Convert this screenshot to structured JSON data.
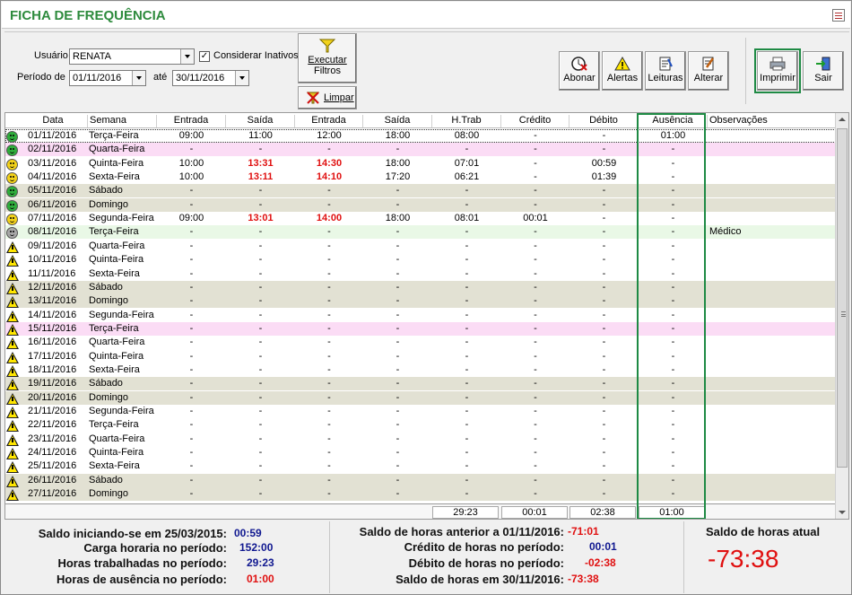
{
  "window": {
    "title": "FICHA DE FREQUÊNCIA"
  },
  "filters": {
    "usuario_label": "Usuário",
    "usuario_value": "RENATA",
    "inativos_label": "Considerar Inativos",
    "inativos_checked": "✓",
    "periodo_label": "Período de",
    "periodo_de": "01/11/2016",
    "ate_label": "até",
    "periodo_ate": "30/11/2016",
    "executar_label1": "Executar",
    "executar_label2": "Filtros",
    "limpar_label": "Limpar"
  },
  "toolbar": {
    "abonar": "Abonar",
    "alertas": "Alertas",
    "leituras": "Leituras",
    "alterar": "Alterar",
    "imprimir": "Imprimir",
    "sair": "Sair"
  },
  "columns": [
    "Data",
    "Semana",
    "Entrada",
    "Saída",
    "Entrada",
    "Saída",
    "H.Trab",
    "Crédito",
    "Débito",
    "Ausência",
    "Observações"
  ],
  "rows": [
    {
      "status": "smile-green",
      "type": "sel",
      "date": "01/11/2016",
      "day": "Terça-Feira",
      "e1": "09:00",
      "s1": "11:00",
      "e2": "12:00",
      "s2": "18:00",
      "ht": "08:00",
      "cr": "-",
      "db": "-",
      "au": "01:00",
      "obs": "",
      "r1": false,
      "r2": false
    },
    {
      "status": "smile-green",
      "type": "holiday",
      "date": "02/11/2016",
      "day": "Quarta-Feira",
      "e1": "-",
      "s1": "-",
      "e2": "-",
      "s2": "-",
      "ht": "-",
      "cr": "-",
      "db": "-",
      "au": "-",
      "obs": ""
    },
    {
      "status": "smile-yellow",
      "type": "",
      "date": "03/11/2016",
      "day": "Quinta-Feira",
      "e1": "10:00",
      "s1": "13:31",
      "e2": "14:30",
      "s2": "18:00",
      "ht": "07:01",
      "cr": "-",
      "db": "00:59",
      "au": "-",
      "obs": "",
      "r1": true,
      "r2": true
    },
    {
      "status": "smile-yellow",
      "type": "",
      "date": "04/11/2016",
      "day": "Sexta-Feira",
      "e1": "10:00",
      "s1": "13:11",
      "e2": "14:10",
      "s2": "17:20",
      "ht": "06:21",
      "cr": "-",
      "db": "01:39",
      "au": "-",
      "obs": "",
      "r1": true,
      "r2": true
    },
    {
      "status": "smile-green",
      "type": "weekend",
      "date": "05/11/2016",
      "day": "Sábado",
      "e1": "-",
      "s1": "-",
      "e2": "-",
      "s2": "-",
      "ht": "-",
      "cr": "-",
      "db": "-",
      "au": "-",
      "obs": ""
    },
    {
      "status": "smile-green",
      "type": "weekend",
      "date": "06/11/2016",
      "day": "Domingo",
      "e1": "-",
      "s1": "-",
      "e2": "-",
      "s2": "-",
      "ht": "-",
      "cr": "-",
      "db": "-",
      "au": "-",
      "obs": ""
    },
    {
      "status": "smile-yellow",
      "type": "",
      "date": "07/11/2016",
      "day": "Segunda-Feira",
      "e1": "09:00",
      "s1": "13:01",
      "e2": "14:00",
      "s2": "18:00",
      "ht": "08:01",
      "cr": "00:01",
      "db": "-",
      "au": "-",
      "obs": "",
      "r1": true,
      "r2": true
    },
    {
      "status": "smile-gray",
      "type": "medic",
      "date": "08/11/2016",
      "day": "Terça-Feira",
      "e1": "-",
      "s1": "-",
      "e2": "-",
      "s2": "-",
      "ht": "-",
      "cr": "-",
      "db": "-",
      "au": "-",
      "obs": "Médico"
    },
    {
      "status": "warn",
      "type": "",
      "date": "09/11/2016",
      "day": "Quarta-Feira",
      "e1": "-",
      "s1": "-",
      "e2": "-",
      "s2": "-",
      "ht": "-",
      "cr": "-",
      "db": "-",
      "au": "-",
      "obs": ""
    },
    {
      "status": "warn",
      "type": "",
      "date": "10/11/2016",
      "day": "Quinta-Feira",
      "e1": "-",
      "s1": "-",
      "e2": "-",
      "s2": "-",
      "ht": "-",
      "cr": "-",
      "db": "-",
      "au": "-",
      "obs": ""
    },
    {
      "status": "warn",
      "type": "",
      "date": "11/11/2016",
      "day": "Sexta-Feira",
      "e1": "-",
      "s1": "-",
      "e2": "-",
      "s2": "-",
      "ht": "-",
      "cr": "-",
      "db": "-",
      "au": "-",
      "obs": ""
    },
    {
      "status": "warn",
      "type": "weekend",
      "date": "12/11/2016",
      "day": "Sábado",
      "e1": "-",
      "s1": "-",
      "e2": "-",
      "s2": "-",
      "ht": "-",
      "cr": "-",
      "db": "-",
      "au": "-",
      "obs": ""
    },
    {
      "status": "warn",
      "type": "weekend",
      "date": "13/11/2016",
      "day": "Domingo",
      "e1": "-",
      "s1": "-",
      "e2": "-",
      "s2": "-",
      "ht": "-",
      "cr": "-",
      "db": "-",
      "au": "-",
      "obs": ""
    },
    {
      "status": "warn",
      "type": "",
      "date": "14/11/2016",
      "day": "Segunda-Feira",
      "e1": "-",
      "s1": "-",
      "e2": "-",
      "s2": "-",
      "ht": "-",
      "cr": "-",
      "db": "-",
      "au": "-",
      "obs": ""
    },
    {
      "status": "warn",
      "type": "holiday",
      "date": "15/11/2016",
      "day": "Terça-Feira",
      "e1": "-",
      "s1": "-",
      "e2": "-",
      "s2": "-",
      "ht": "-",
      "cr": "-",
      "db": "-",
      "au": "-",
      "obs": ""
    },
    {
      "status": "warn",
      "type": "",
      "date": "16/11/2016",
      "day": "Quarta-Feira",
      "e1": "-",
      "s1": "-",
      "e2": "-",
      "s2": "-",
      "ht": "-",
      "cr": "-",
      "db": "-",
      "au": "-",
      "obs": ""
    },
    {
      "status": "warn",
      "type": "",
      "date": "17/11/2016",
      "day": "Quinta-Feira",
      "e1": "-",
      "s1": "-",
      "e2": "-",
      "s2": "-",
      "ht": "-",
      "cr": "-",
      "db": "-",
      "au": "-",
      "obs": ""
    },
    {
      "status": "warn",
      "type": "",
      "date": "18/11/2016",
      "day": "Sexta-Feira",
      "e1": "-",
      "s1": "-",
      "e2": "-",
      "s2": "-",
      "ht": "-",
      "cr": "-",
      "db": "-",
      "au": "-",
      "obs": ""
    },
    {
      "status": "warn",
      "type": "weekend",
      "date": "19/11/2016",
      "day": "Sábado",
      "e1": "-",
      "s1": "-",
      "e2": "-",
      "s2": "-",
      "ht": "-",
      "cr": "-",
      "db": "-",
      "au": "-",
      "obs": ""
    },
    {
      "status": "warn",
      "type": "weekend",
      "date": "20/11/2016",
      "day": "Domingo",
      "e1": "-",
      "s1": "-",
      "e2": "-",
      "s2": "-",
      "ht": "-",
      "cr": "-",
      "db": "-",
      "au": "-",
      "obs": ""
    },
    {
      "status": "warn",
      "type": "",
      "date": "21/11/2016",
      "day": "Segunda-Feira",
      "e1": "-",
      "s1": "-",
      "e2": "-",
      "s2": "-",
      "ht": "-",
      "cr": "-",
      "db": "-",
      "au": "-",
      "obs": ""
    },
    {
      "status": "warn",
      "type": "",
      "date": "22/11/2016",
      "day": "Terça-Feira",
      "e1": "-",
      "s1": "-",
      "e2": "-",
      "s2": "-",
      "ht": "-",
      "cr": "-",
      "db": "-",
      "au": "-",
      "obs": ""
    },
    {
      "status": "warn",
      "type": "",
      "date": "23/11/2016",
      "day": "Quarta-Feira",
      "e1": "-",
      "s1": "-",
      "e2": "-",
      "s2": "-",
      "ht": "-",
      "cr": "-",
      "db": "-",
      "au": "-",
      "obs": ""
    },
    {
      "status": "warn",
      "type": "",
      "date": "24/11/2016",
      "day": "Quinta-Feira",
      "e1": "-",
      "s1": "-",
      "e2": "-",
      "s2": "-",
      "ht": "-",
      "cr": "-",
      "db": "-",
      "au": "-",
      "obs": ""
    },
    {
      "status": "warn",
      "type": "",
      "date": "25/11/2016",
      "day": "Sexta-Feira",
      "e1": "-",
      "s1": "-",
      "e2": "-",
      "s2": "-",
      "ht": "-",
      "cr": "-",
      "db": "-",
      "au": "-",
      "obs": ""
    },
    {
      "status": "warn",
      "type": "weekend",
      "date": "26/11/2016",
      "day": "Sábado",
      "e1": "-",
      "s1": "-",
      "e2": "-",
      "s2": "-",
      "ht": "-",
      "cr": "-",
      "db": "-",
      "au": "-",
      "obs": ""
    },
    {
      "status": "warn",
      "type": "weekend",
      "date": "27/11/2016",
      "day": "Domingo",
      "e1": "-",
      "s1": "-",
      "e2": "-",
      "s2": "-",
      "ht": "-",
      "cr": "-",
      "db": "-",
      "au": "-",
      "obs": ""
    }
  ],
  "totals": {
    "htrab": "29:23",
    "credito": "00:01",
    "debito": "02:38",
    "ausencia": "01:00"
  },
  "summary": {
    "saldo_inicio_label": "Saldo iniciando-se em 25/03/2015:",
    "saldo_inicio_value": "00:59",
    "carga_label": "Carga horaria no período:",
    "carga_value": "152:00",
    "trab_label": "Horas trabalhadas no período:",
    "trab_value": "29:23",
    "aus_label": "Horas de ausência no período:",
    "aus_value": "01:00",
    "saldo_ant_label": "Saldo de horas anterior a 01/11/2016:",
    "saldo_ant_value": "-71:01",
    "cred_label": "Crédito de horas no período:",
    "cred_value": "00:01",
    "deb_label": "Débito de horas no período:",
    "deb_value": "-02:38",
    "saldo_fim_label": "Saldo de horas em 30/11/2016:",
    "saldo_fim_value": "-73:38",
    "atual_label": "Saldo de horas atual",
    "atual_value": "-73:38"
  },
  "colors": {
    "accent_green": "#1e8a44",
    "title_green": "#2e8b3d",
    "negative_red": "#e01010",
    "value_blue": "#101890",
    "weekend_bg": "#e2e1d3",
    "holiday_bg": "#fbdcf5"
  },
  "icons": [
    "menu-icon",
    "abonar-icon",
    "alertas-icon",
    "leituras-icon",
    "alterar-icon",
    "imprimir-icon",
    "sair-icon",
    "funnel-icon",
    "limpar-icon",
    "smiley-icon",
    "warning-icon"
  ]
}
